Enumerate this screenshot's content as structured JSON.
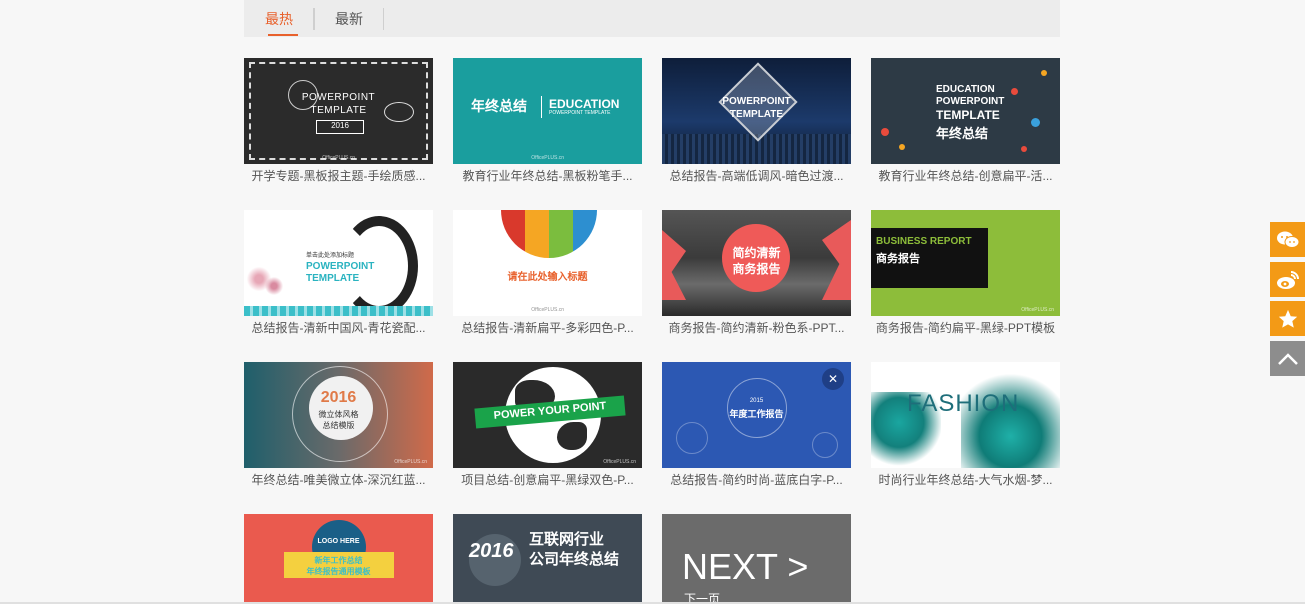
{
  "tabs": [
    {
      "label": "最热",
      "active": true
    },
    {
      "label": "最新",
      "active": false
    }
  ],
  "accent": "#e8612c",
  "templates": [
    {
      "caption": "开学专题-黑板报主题-手绘质感...",
      "text": [
        "POWERPOINT",
        "TEMPLATE",
        "2016"
      ]
    },
    {
      "caption": "教育行业年终总结-黑板粉笔手...",
      "text": [
        "年终总结",
        "EDUCATION",
        "POWERPOINT TEMPLATE"
      ]
    },
    {
      "caption": "总结报告-高端低调风-暗色过渡...",
      "text": [
        "POWERPOINT",
        "TEMPLATE"
      ]
    },
    {
      "caption": "教育行业年终总结-创意扁平-活...",
      "text": [
        "EDUCATION",
        "POWERPOINT",
        "TEMPLATE",
        "年终总结"
      ]
    },
    {
      "caption": "总结报告-清新中国风-青花瓷配...",
      "text": [
        "单击此处添加标题",
        "POWERPOINT",
        "TEMPLATE"
      ]
    },
    {
      "caption": "总结报告-清新扁平-多彩四色-P...",
      "text": [
        "请在此处输入标题"
      ]
    },
    {
      "caption": "商务报告-简约清新-粉色系-PPT...",
      "text": [
        "简约清新",
        "商务报告"
      ]
    },
    {
      "caption": "商务报告-简约扁平-黑绿-PPT模板",
      "text": [
        "BUSINESS REPORT",
        "商务报告"
      ]
    },
    {
      "caption": "年终总结-唯美微立体-深沉红蓝...",
      "text": [
        "2016",
        "微立体风格",
        "总结模版"
      ]
    },
    {
      "caption": "项目总结-创意扁平-黑绿双色-P...",
      "text": [
        "POWER YOUR POINT"
      ]
    },
    {
      "caption": "总结报告-简约时尚-蓝底白字-P...",
      "text": [
        "2015",
        "年度工作报告"
      ]
    },
    {
      "caption": "时尚行业年终总结-大气水烟-梦...",
      "text": [
        "FASHION"
      ]
    },
    {
      "caption": "",
      "text": [
        "LOGO HERE",
        "新年工作总结",
        "年终报告通用模板"
      ]
    },
    {
      "caption": "",
      "text": [
        "2016",
        "互联网行业",
        "公司年终总结"
      ]
    }
  ],
  "next": {
    "label": "NEXT >",
    "sub": "下一页"
  },
  "watermark": "OfficePLUS.cn",
  "sidebar": [
    {
      "icon": "wechat-icon"
    },
    {
      "icon": "weibo-icon"
    },
    {
      "icon": "star-icon"
    },
    {
      "icon": "chevron-up-icon"
    }
  ]
}
